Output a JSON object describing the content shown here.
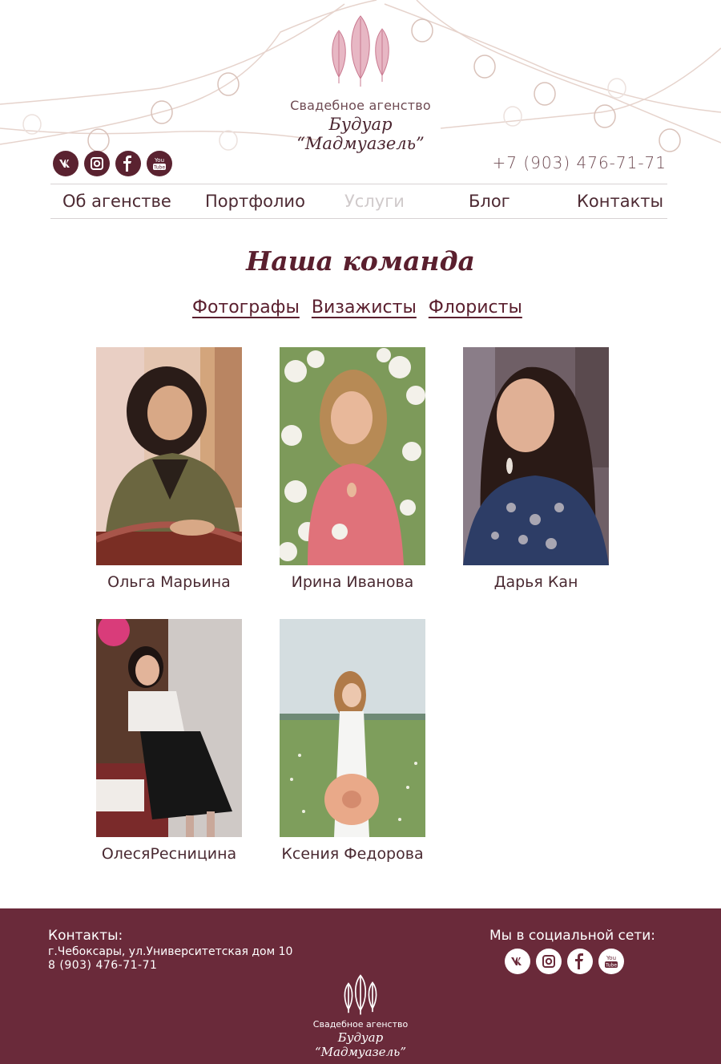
{
  "header": {
    "agency_label": "Свадебное агенство",
    "brand_name": "Будуар “Мадмуазель”",
    "phone": "+7 (903) 476-71-71",
    "socials": [
      {
        "name": "vk-icon",
        "glyph": "vk"
      },
      {
        "name": "instagram-icon",
        "glyph": "ig"
      },
      {
        "name": "facebook-icon",
        "glyph": "f"
      },
      {
        "name": "youtube-icon",
        "glyph": "You Tube"
      }
    ]
  },
  "nav": {
    "items": [
      {
        "label": "Об агенстве",
        "active": false
      },
      {
        "label": "Портфолио",
        "active": false
      },
      {
        "label": "Услуги",
        "active": true
      },
      {
        "label": "Блог",
        "active": false
      },
      {
        "label": "Контакты",
        "active": false
      }
    ]
  },
  "team": {
    "title": "Наша команда",
    "filters": [
      "Фотографы",
      "Визажисты",
      "Флористы"
    ],
    "members": [
      {
        "name": "Ольга Марьина"
      },
      {
        "name": "Ирина Иванова"
      },
      {
        "name": "Дарья Кан"
      },
      {
        "name": "ОлесяРесницина"
      },
      {
        "name": "Ксения Федорова"
      }
    ]
  },
  "footer": {
    "contacts_title": "Контакты:",
    "address": "г.Чебоксары, ул.Университетская дом 10",
    "phone": "8 (903) 476-71-71",
    "social_title": "Мы в социальной сети:",
    "agency_label": "Свадебное агенство",
    "brand_name": "Будуар “Мадмуазель”"
  },
  "colors": {
    "brand": "#5a2230",
    "footer_bg": "#6a2a3a",
    "nav_active": "#d0cacb",
    "feather_pink": "#d88a9e"
  }
}
